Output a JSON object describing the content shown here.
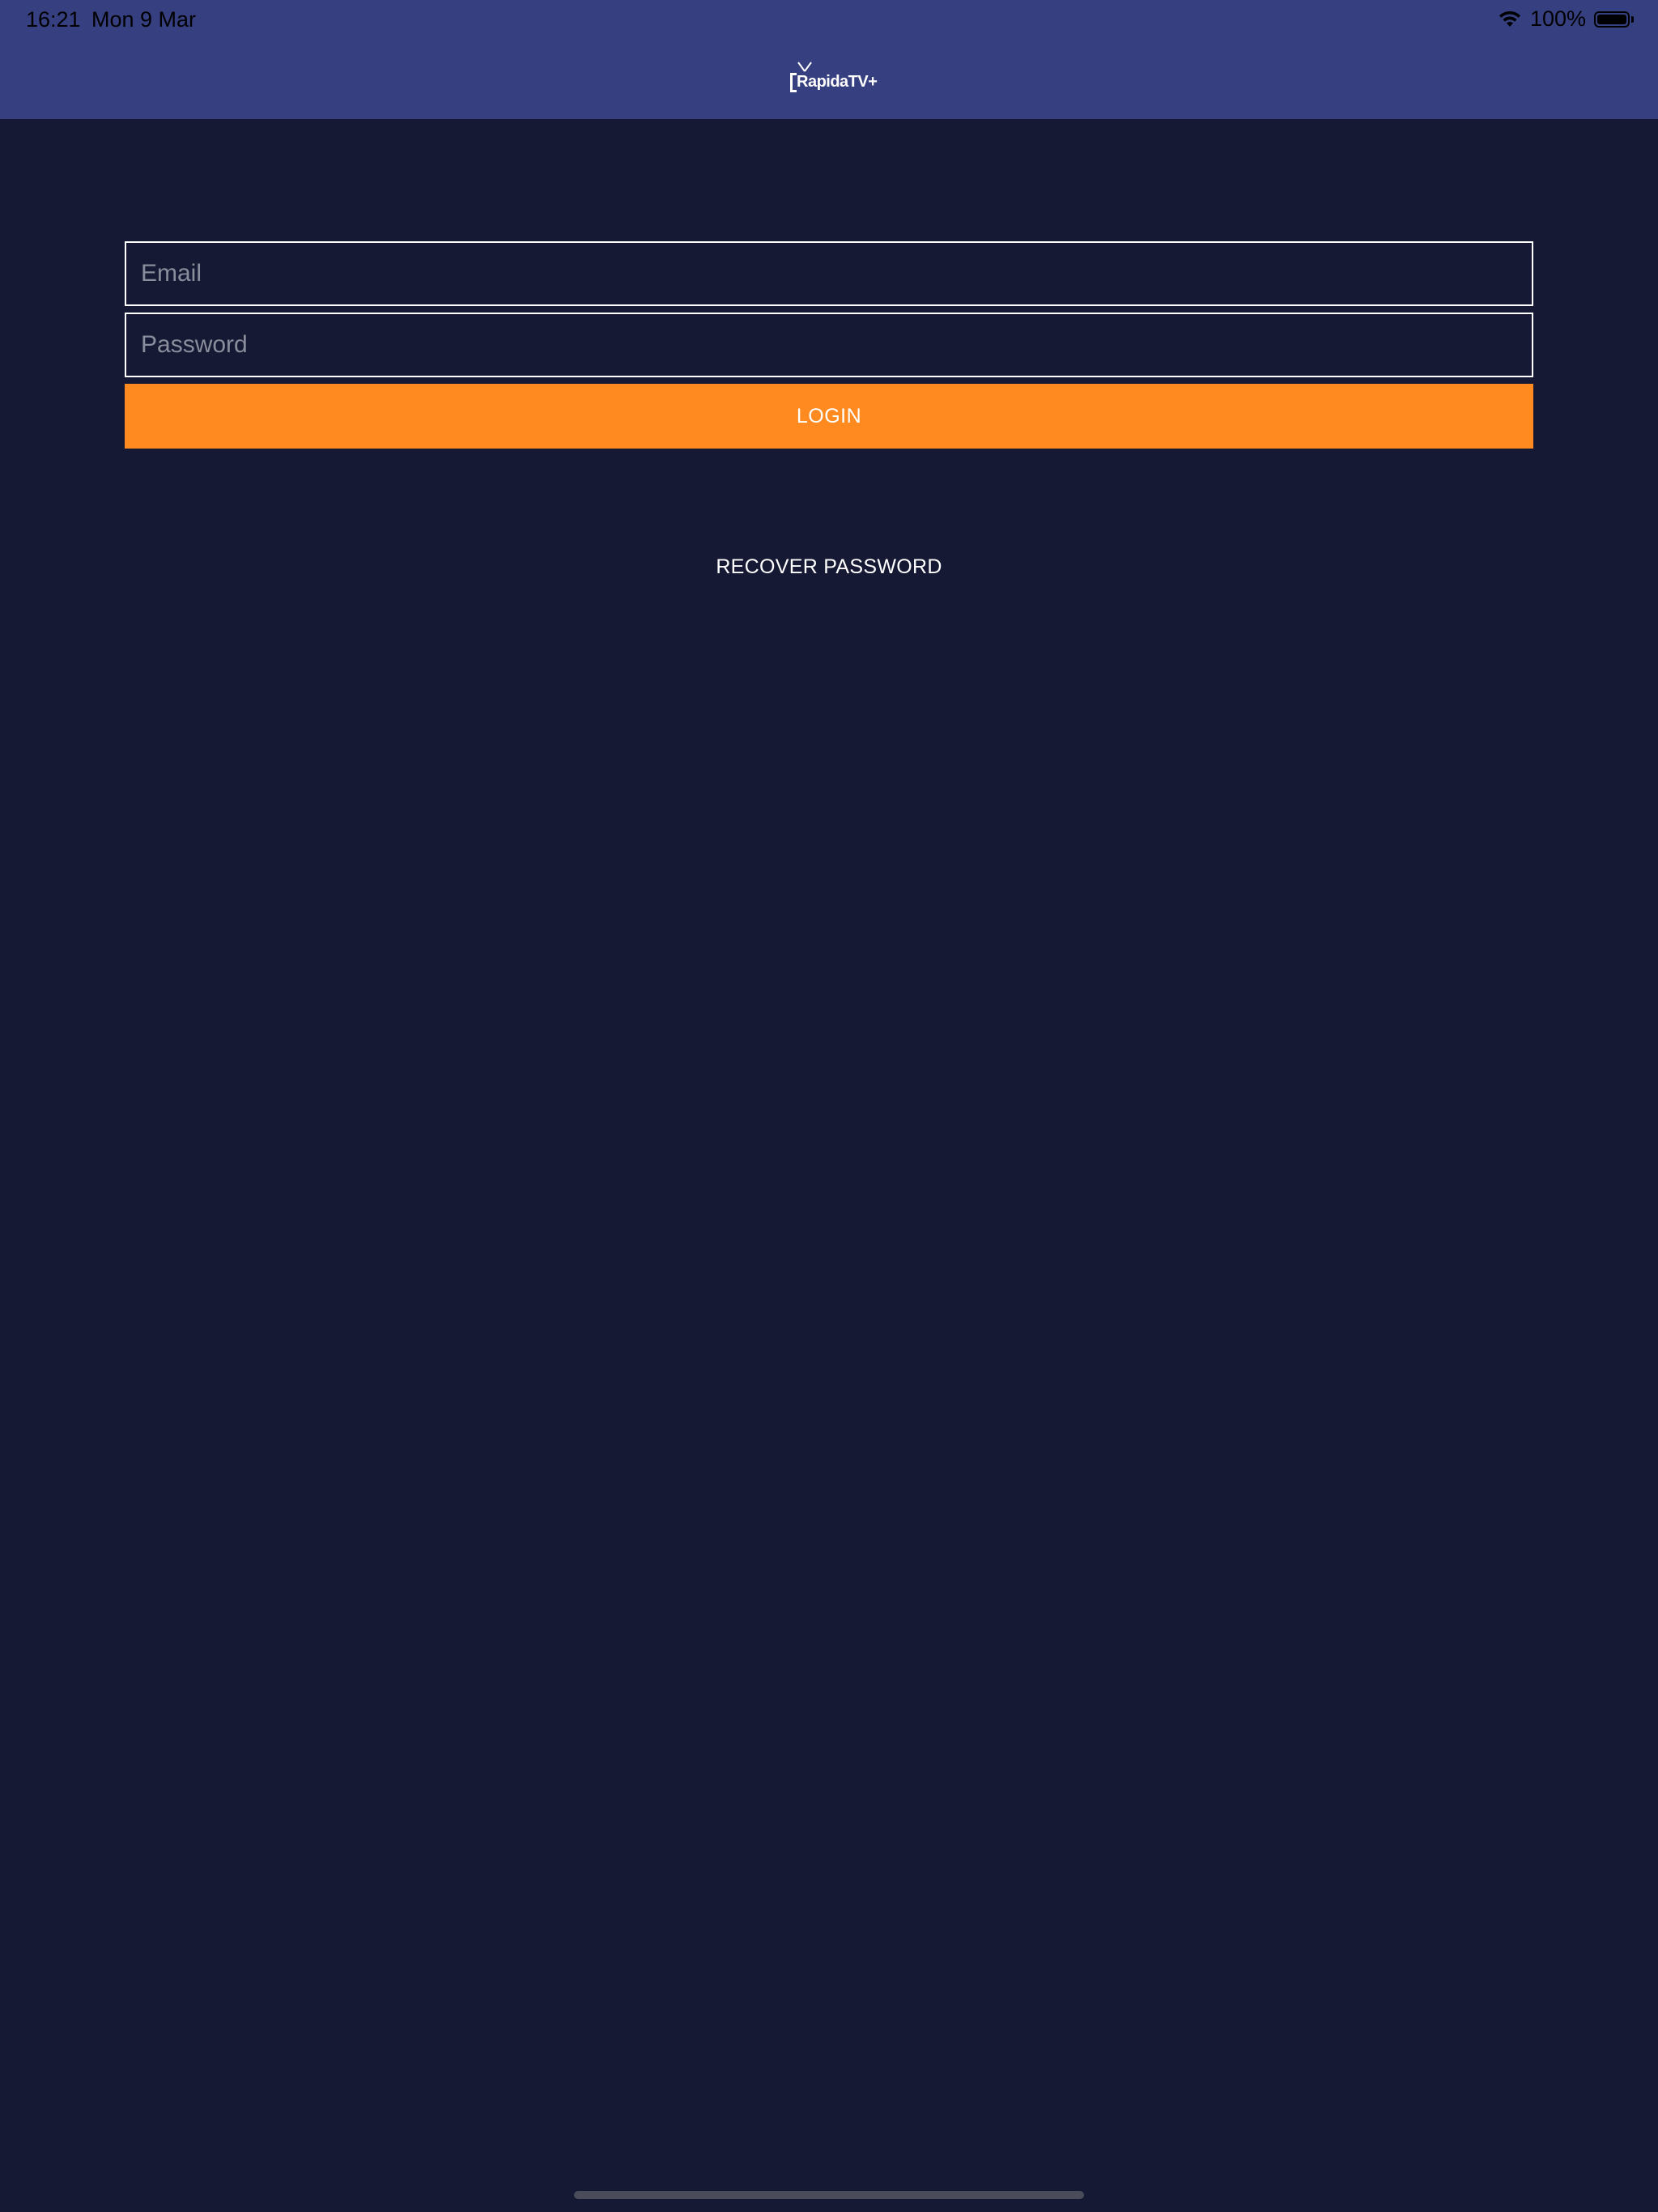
{
  "status_bar": {
    "time": "16:21",
    "date": "Mon 9 Mar",
    "battery": "100%",
    "wifi_icon": "wifi-icon",
    "battery_icon": "battery-icon"
  },
  "header": {
    "logo_text": "RapidaTV+"
  },
  "form": {
    "email_placeholder": "Email",
    "email_value": "",
    "password_placeholder": "Password",
    "password_value": "",
    "login_label": "LOGIN"
  },
  "recover": {
    "label": "RECOVER PASSWORD"
  },
  "colors": {
    "header_bg": "#363f80",
    "page_bg": "#151934",
    "login_button": "#ff8a20",
    "text": "#ffffff"
  }
}
